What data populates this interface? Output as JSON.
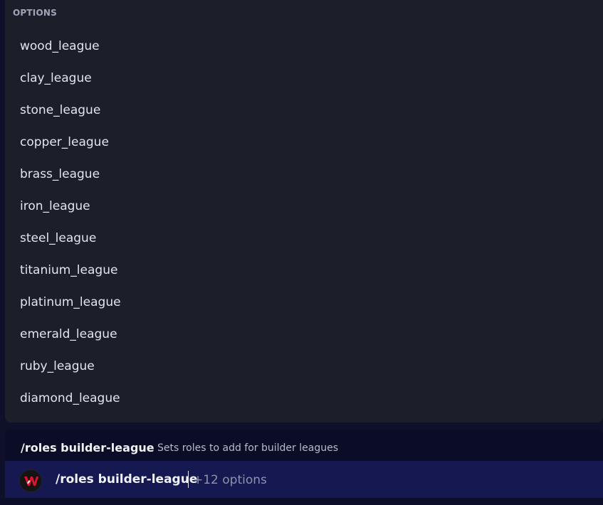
{
  "options_panel": {
    "header": "OPTIONS",
    "items": [
      "wood_league",
      "clay_league",
      "stone_league",
      "copper_league",
      "brass_league",
      "iron_league",
      "steel_league",
      "titanium_league",
      "platinum_league",
      "emerald_league",
      "ruby_league",
      "diamond_league"
    ]
  },
  "command_bar": {
    "name": "/roles builder-league",
    "description": "Sets roles to add for builder leagues"
  },
  "input": {
    "command": "/roles builder-league",
    "hint": "+12 options",
    "avatar_icon": "app-avatar-icon"
  },
  "colors": {
    "panel_bg": "#1c1e29",
    "page_bg": "#0f1029",
    "input_bg": "#161852",
    "text": "#e3e5ec",
    "muted": "#8f93a8",
    "accent_red": "#e0122b"
  }
}
